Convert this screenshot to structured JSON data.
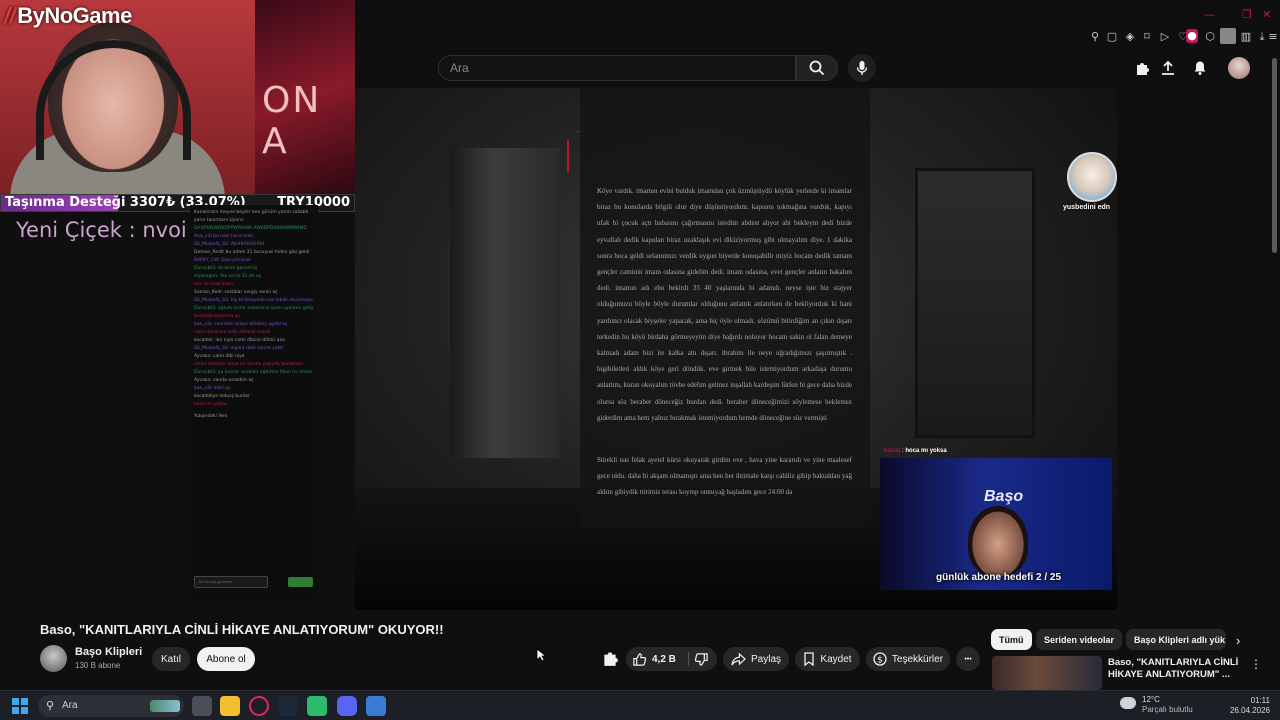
{
  "stream_overlay": {
    "brand": "ByNoGame",
    "donation_label": "Taşınma Desteği 3307₺ (33.07%)",
    "donation_target": "TRY10000",
    "donation_progress": 0.3307,
    "poster_text": "ON A",
    "alert_text": "Yeni Çiçek : nvoi mitsbrex",
    "chat_lines": [
      {
        "user": "",
        "text": "Kanalinizin meyve beyler ben görüm yarım sallabh",
        "cls": ""
      },
      {
        "user": "",
        "text": "yarın tanımlanı Uyarıs",
        "cls": ""
      },
      {
        "user": "Yulimdb",
        "text": "DADPDNWDKDPPWWAWK AWKDPDSNWAWMWMD",
        "cls": "u1"
      },
      {
        "user": "",
        "text": "Ana_v3i bu nasi hoca amk",
        "cls": "u2"
      },
      {
        "user": "",
        "text": "SS_Mustafa_SS: AJHHHSHSHSH",
        "cls": "u2"
      },
      {
        "user": "",
        "text": "Demon_Redit bu adam 31 buruyusi hiden gibi geldi",
        "cls": ""
      },
      {
        "user": "",
        "text": "R4RKY_CW: Saol yücücok",
        "cls": "u2"
      },
      {
        "user": "",
        "text": "Dossybt3: ibrahim gecermiş",
        "cls": "u1"
      },
      {
        "user": "",
        "text": "ziyakagen: Tek sıcrık 31 ml aç",
        "cls": "u1"
      },
      {
        "user": "",
        "text": "nas ve hoat Icom",
        "cls": "u3"
      },
      {
        "user": "",
        "text": "Saman_Kedi: saldalar vergiy senki aç",
        "cls": ""
      },
      {
        "user": "",
        "text": "SS_Mustafa_SS: hiç bi hikayede nas lebak okunmuyo ki aç",
        "cls": "u2"
      },
      {
        "user": "",
        "text": "Dossybt3: oğlum cinler adamanız şuan uyurken geliyiniz amk",
        "cls": "u1"
      },
      {
        "user": "",
        "text": "burlarda kaşınma aç",
        "cls": "u3"
      },
      {
        "user": "",
        "text": "kaa_v3i: cennetin araya döldüsy agdal aç",
        "cls": "u2"
      },
      {
        "user": "",
        "text": "cami duvarina sidik dikmek mesik",
        "cls": "u3"
      },
      {
        "user": "",
        "text": "kocadeli: ian niye cami dibine döktü aaa",
        "cls": ""
      },
      {
        "user": "",
        "text": "SS_Mustafa_SS: sigara dedi zanım çekti",
        "cls": "u2"
      },
      {
        "user": "",
        "text": "Ayvalıa: cami dibi niye",
        "cls": ""
      },
      {
        "user": "",
        "text": "cinler dehenin doye ne yarına yaşıyda burdanda",
        "cls": "u3"
      },
      {
        "user": "",
        "text": "Dossybt3: ya bunlar ucakları eğitimle falan mı Imam olduklar aç",
        "cls": "u1"
      },
      {
        "user": "",
        "text": "Ayvalıa: cenda essedim aç",
        "cls": ""
      },
      {
        "user": "",
        "text": "kaa_v3i: katıl aç",
        "cls": "u2"
      },
      {
        "user": "",
        "text": "kocadeliye oldusş bunlar",
        "cls": ""
      },
      {
        "user": "",
        "text": "hoca mı yoksa",
        "cls": "u3"
      }
    ],
    "chat_paused": "Yukarıdaki Yeni",
    "chat_placeholder": "Bir mesaj gönderin"
  },
  "browser": {
    "window_controls": [
      "—",
      "❐",
      "✕"
    ],
    "extensions": [
      "pin",
      "tab",
      "shield",
      "bookmark",
      "play",
      "heart",
      "ext-pink",
      "puzzle",
      "profile",
      "bar",
      "download",
      "menu"
    ]
  },
  "masthead": {
    "search_placeholder": "Ara"
  },
  "video": {
    "paper_paragraphs": [
      "Köye vardık. imamın evini bulduk imamdan çok üzmüştüydü köylük yerlerde ki imamlar biraz bu konularda bilgili olur diye düşünüyordum. kapısını tokmağına vurduk, kapıyı ufak bi çocuk açtı babasını çağırmasını istedim abdest alıyor abi bekleyin dedi bizde eyvallah dedik kapıdan biraz uzaklaşık evi dikiziyormuş gibi olmayalım diye. 1 dakika sonra hoca geldi selamımızı verdik uygun biyerde konuşabilir miyiz hocam dedik tamam gençler caminin imam odasına gidelim dedi. imam odasına, evet gençler anlatın bakalım dedi. imamın adı ebu bekirdi 35 40 yaşlarında bi adamdı. neyse işte biz stajyer olduğumuzu böyle böyle durumlar olduğunu anlattık anlatırken de bekliyorduk ki hani yardımcı olacak biyşeler yapacak, ama hiç öyle olmadı. sözümü bitirdiğim an çıkın dışarı terkedin bu köyü birdaha görmeyeyim diye bağırdı noluyor hocam sakin ol falan demeye kalmadı adam bizi ite kalka attı dışarı. ibrahim ile neye uğradığımızı şaşırmıştık . bigibiletleri aldık köye geri döndük. eve girmek bile istemiyordum arkadaşa durumu anlattım, kuran okuyalım tövbe edelim gelmez inşallah kardeşim lütfen bi gece daha bizde olursa söz beraber döneceğiz burdan dedi. beraber döneceğimizi söylemese beklemez giderdim ama hem yalnız bırakmak istemiyordum hemde döneceğine söz vermişti",
      "Sürekli nas felak ayetel kürsi okuyarak girdim eve , hava yine kararıdı ve yine maalesef gece oldu. daha bi akşam olmamıştı ama ben her ihtimale karşı cahiliz gibip baktaldan yağ aldım gibiydik titrimiz terası koymp onmıyağ başladım gece 24:00 da"
    ],
    "viewer_name": "yusbedini edn",
    "cam2_chat": "hoca mı yoksa",
    "cam2_chat_user": "basoq",
    "cam2_logo": "Başo",
    "sub_goal": "günlük abone hedefi 2 / 25"
  },
  "info": {
    "title": "Baso, \"KANITLARIYLA CİNLİ HİKAYE ANLATIYORUM\" OKUYOR!!",
    "channel_name": "Başo Klipleri",
    "subscribers": "130 B abone",
    "join_label": "Katıl",
    "subscribe_label": "Abone ol",
    "like_count": "4,2 B",
    "share_label": "Paylaş",
    "save_label": "Kaydet",
    "thanks_label": "Teşekkürler",
    "more_label": "•••"
  },
  "side_panel": {
    "chips": [
      "Tümü",
      "Seriden videolar",
      "Başo Klipleri adlı yük"
    ],
    "rec_title": "Baso, \"KANITLARIYLA CİNLİ HİKAYE ANLATIYORUM\" ..."
  },
  "taskbar": {
    "search_label": "Ara",
    "temp": "12°C",
    "weather": "Parçalı bulutlu",
    "time": "01:11",
    "date": "26.04.2026"
  },
  "colors": {
    "accent": "#c2185b",
    "yt_bg": "#0f0f0f",
    "pill": "#272727"
  }
}
